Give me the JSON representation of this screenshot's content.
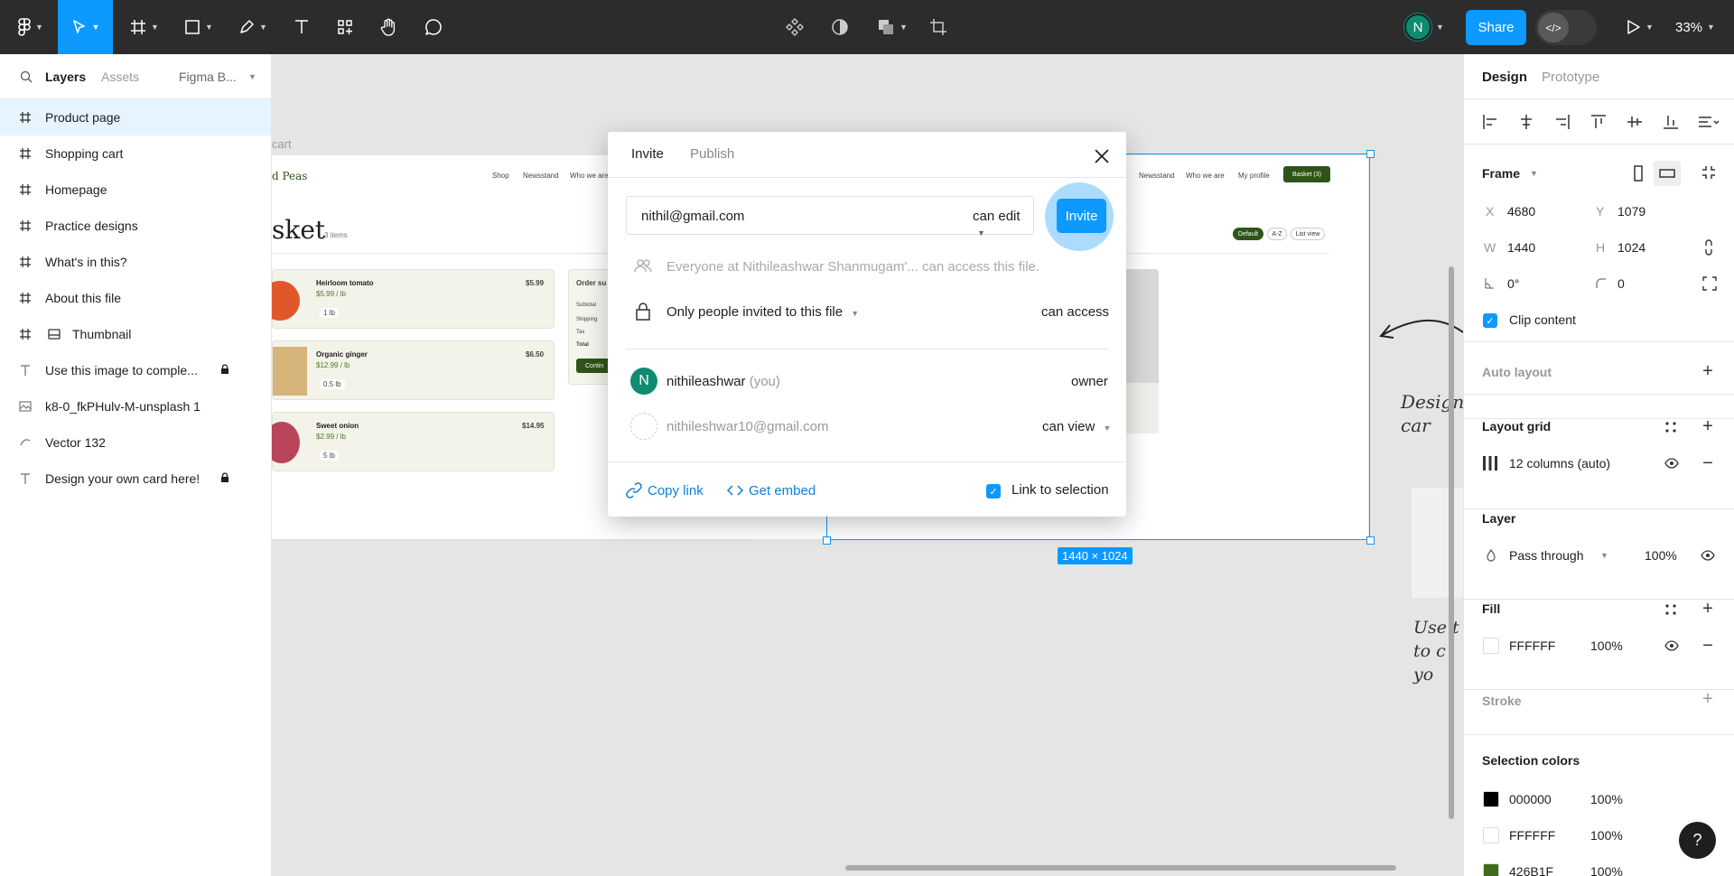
{
  "toolbar": {
    "zoom": "33%",
    "share_label": "Share",
    "user_initial": "N",
    "dev_mode_glyph": "</>"
  },
  "left_panel": {
    "tabs": {
      "layers": "Layers",
      "assets": "Assets",
      "page": "Figma B..."
    },
    "layers": [
      {
        "label": "Product page",
        "icon": "frame-icon",
        "selected": true
      },
      {
        "label": "Shopping cart",
        "icon": "frame-icon"
      },
      {
        "label": "Homepage",
        "icon": "frame-icon"
      },
      {
        "label": "Practice designs",
        "icon": "frame-icon"
      },
      {
        "label": "What's in this?",
        "icon": "frame-icon"
      },
      {
        "label": "About this file",
        "icon": "frame-icon"
      },
      {
        "label": "Thumbnail",
        "icon": "frame-icon"
      },
      {
        "label": "Use this image to comple...",
        "icon": "text-icon",
        "locked": true
      },
      {
        "label": "k8-0_fkPHulv-M-unsplash 1",
        "icon": "image-icon"
      },
      {
        "label": "Vector 132",
        "icon": "vector-icon"
      },
      {
        "label": "Design your own card here!",
        "icon": "text-icon",
        "locked": true
      }
    ]
  },
  "canvas": {
    "frame_label_cart": "cart",
    "mock": {
      "brand": "d Peas",
      "nav": [
        "Shop",
        "Newsstand",
        "Who we are"
      ],
      "nav_right": [
        "Newsstand",
        "Who we are",
        "My profile"
      ],
      "basket_btn": "Basket (3)",
      "heading": "sket",
      "items_count": "3 items",
      "view_btns": [
        "Default",
        "A-Z",
        "List view"
      ],
      "order_summary": "Order su",
      "summary_rows": [
        "Subtotal",
        "Shipping",
        "Tax",
        "Total"
      ],
      "continue": "Contin",
      "products": [
        {
          "name": "Heirloom tomato",
          "price": "$5.99 / lb",
          "total": "$5.99",
          "qty": "1 lb"
        },
        {
          "name": "Organic ginger",
          "price": "$12.99 / lb",
          "total": "$6.50",
          "qty": "0.5 lb"
        },
        {
          "name": "Sweet onion",
          "price": "$2.99 / lb",
          "total": "$14.95",
          "qty": "5 lb"
        }
      ]
    },
    "dimensions": "1440 × 1024",
    "handwriting_1": "Design\ncar",
    "handwriting_2": "Use t\nto c\nyo"
  },
  "modal": {
    "tabs": {
      "invite": "Invite",
      "publish": "Publish"
    },
    "email_value": "nithil@gmail.com",
    "email_permission": "can edit",
    "invite_label": "Invite",
    "org_access": "Everyone at Nithileashwar Shanmugam'... can access this file.",
    "access_scope": "Only people invited to this file",
    "access_level": "can access",
    "people": [
      {
        "name": "nithileashwar",
        "suffix": "(you)",
        "role": "owner",
        "initial": "N"
      },
      {
        "name": "nithileshwar10@gmail.com",
        "role": "can view"
      }
    ],
    "copy_link": "Copy link",
    "get_embed": "Get embed",
    "link_to_selection": "Link to selection"
  },
  "right_panel": {
    "tabs": {
      "design": "Design",
      "prototype": "Prototype"
    },
    "frame": {
      "label": "Frame",
      "x_label": "X",
      "x": "4680",
      "y_label": "Y",
      "y": "1079",
      "w_label": "W",
      "w": "1440",
      "h_label": "H",
      "h": "1024",
      "rotation": "0°",
      "radius": "0",
      "clip_content": "Clip content"
    },
    "auto_layout": "Auto layout",
    "layout_grid": {
      "title": "Layout grid",
      "value": "12 columns (auto)"
    },
    "layer": {
      "title": "Layer",
      "blend": "Pass through",
      "opacity": "100%"
    },
    "fill": {
      "title": "Fill",
      "hex": "FFFFFF",
      "opacity": "100%"
    },
    "stroke": "Stroke",
    "selection_colors": {
      "title": "Selection colors",
      "colors": [
        {
          "hex": "000000",
          "opacity": "100%",
          "swatch": "#000000"
        },
        {
          "hex": "FFFFFF",
          "opacity": "100%",
          "swatch": "#FFFFFF"
        },
        {
          "hex": "426B1F",
          "opacity": "100%",
          "swatch": "#426B1F"
        }
      ]
    },
    "help": "?"
  },
  "colors": {
    "accent": "#0d99ff",
    "toolbar": "#2c2c2c",
    "avatar": "#0f8b72"
  }
}
